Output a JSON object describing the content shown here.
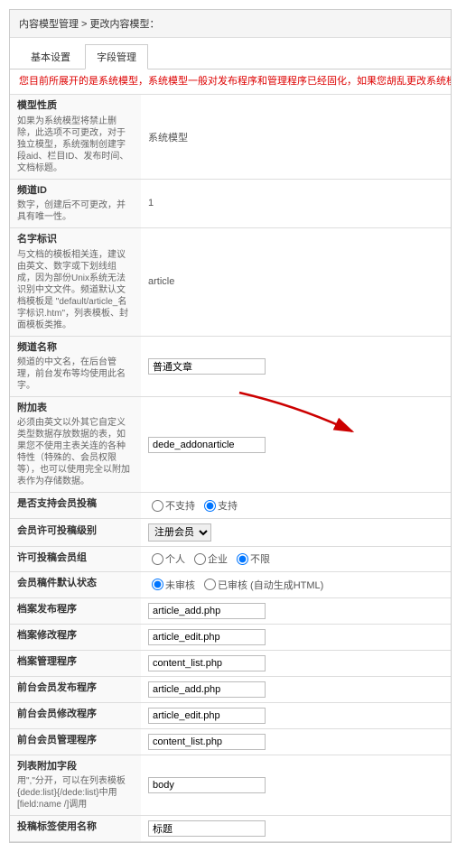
{
  "breadcrumb": "内容模型管理 > 更改内容模型：",
  "tabs": {
    "basic": "基本设置",
    "fields": "字段管理"
  },
  "warning": "您目前所展开的是系统模型，系统模型一般对发布程序和管理程序已经固化，如果您胡乱更改系统模型将会导致使用这件内容类型的频道可能",
  "rows": {
    "modelType": {
      "title": "模型性质",
      "desc": "如果为系统模型将禁止删除，此选项不可更改，对于独立模型，系统强制创建字段aid、栏目ID、发布时间、文档标题。",
      "value": "系统模型"
    },
    "channelId": {
      "title": "频道ID",
      "desc": "数字，创建后不可更改，并具有唯一性。",
      "value": "1"
    },
    "nameTag": {
      "title": "名字标识",
      "desc": "与文档的模板相关连，建议由英文、数字或下划线组成，因为部份Unix系统无法识别中文文件。频道默认文档模板是 \"default/article_名字标识.htm\"，列表模板、封面模板类推。",
      "value": "article"
    },
    "channelName": {
      "title": "频道名称",
      "desc": "频道的中文名，在后台管理，前台发布等均使用此名字。",
      "value": "普通文章"
    },
    "addonTable": {
      "title": "附加表",
      "desc": "必须由英文以外其它自定义类型数据存放数据的表，如果您不使用主表关连的各种特性（特殊的、会员权限等），也可以使用完全以附加表作为存储数据。",
      "value": "dede_addonarticle"
    },
    "memberPost": {
      "title": "是否支持会员投稿",
      "opt1": "不支持",
      "opt2": "支持"
    },
    "memberLevel": {
      "title": "会员许可投稿级别",
      "value": "注册会员"
    },
    "memberGroup": {
      "title": "许可投稿会员组",
      "opt1": "个人",
      "opt2": "企业",
      "opt3": "不限"
    },
    "defaultStatus": {
      "title": "会员稿件默认状态",
      "opt1": "未审核",
      "opt2": "已审核 (自动生成HTML)"
    },
    "publishProg": {
      "title": "档案发布程序",
      "value": "article_add.php"
    },
    "editProg": {
      "title": "档案修改程序",
      "value": "article_edit.php"
    },
    "manageProg": {
      "title": "档案管理程序",
      "value": "content_list.php"
    },
    "frontPublish": {
      "title": "前台会员发布程序",
      "value": "article_add.php"
    },
    "frontEdit": {
      "title": "前台会员修改程序",
      "value": "article_edit.php"
    },
    "frontManage": {
      "title": "前台会员管理程序",
      "value": "content_list.php"
    },
    "listField": {
      "title": "列表附加字段",
      "desc": "用\",\"分开，可以在列表模板{dede:list}{/dede:list}中用[field:name /]调用",
      "value": "body"
    },
    "tagTemplate": {
      "title": "投稿标签使用名称",
      "value": "标题"
    }
  }
}
